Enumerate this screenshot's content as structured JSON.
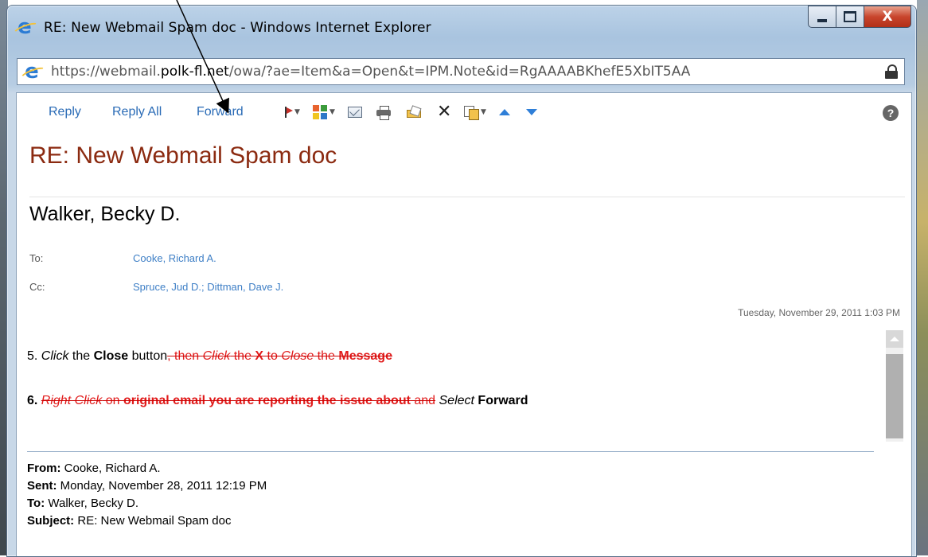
{
  "window": {
    "title": "RE: New Webmail Spam doc - Windows Internet Explorer",
    "close_glyph": "X"
  },
  "address": {
    "scheme": "https://webmail.",
    "domain": "polk-fl.net",
    "path": "/owa/?ae=Item&a=Open&t=IPM.Note&id=RgAAAABKhefE5XbIT5AA"
  },
  "toolbar": {
    "reply_label": "Reply",
    "reply_all_label": "Reply All",
    "forward_label": "Forward",
    "help_label": "?"
  },
  "message": {
    "subject": "RE: New Webmail Spam doc",
    "sender": "Walker, Becky D.",
    "to_label": "To:",
    "to_value": "Cooke, Richard A.",
    "cc_label": "Cc:",
    "cc_value": "Spruce, Jud D.; Dittman, Dave J.",
    "datetime": "Tuesday, November 29, 2011 1:03 PM"
  },
  "body": {
    "step5": {
      "num": "5. ",
      "click": "Click",
      "the": " the ",
      "close": "Close",
      "button": " button",
      "strike_then": ", then ",
      "strike_click": "Click",
      "strike_the": " the ",
      "strike_x": "X",
      "strike_to": " to ",
      "strike_close": "Close",
      "strike_the2": " the ",
      "strike_message": "Message"
    },
    "step6": {
      "num": "6. ",
      "strike_rightclick": "Right Click",
      "strike_on": " on ",
      "strike_original": "original email you are reporting the issue about",
      "strike_and": " and",
      "select": " Select",
      "forward": " Forward"
    }
  },
  "quoted": {
    "from_label": "From:",
    "from_value": " Cooke, Richard A.",
    "sent_label": "Sent:",
    "sent_value": " Monday, November 28, 2011 12:19 PM",
    "to_label": "To:",
    "to_value": " Walker, Becky D.",
    "subject_label": "Subject:",
    "subject_value": " RE: New Webmail Spam doc"
  },
  "colors": {
    "link_blue": "#2a6bb6",
    "subject_red": "#8b2a10",
    "strike_red": "#e11b1b"
  }
}
